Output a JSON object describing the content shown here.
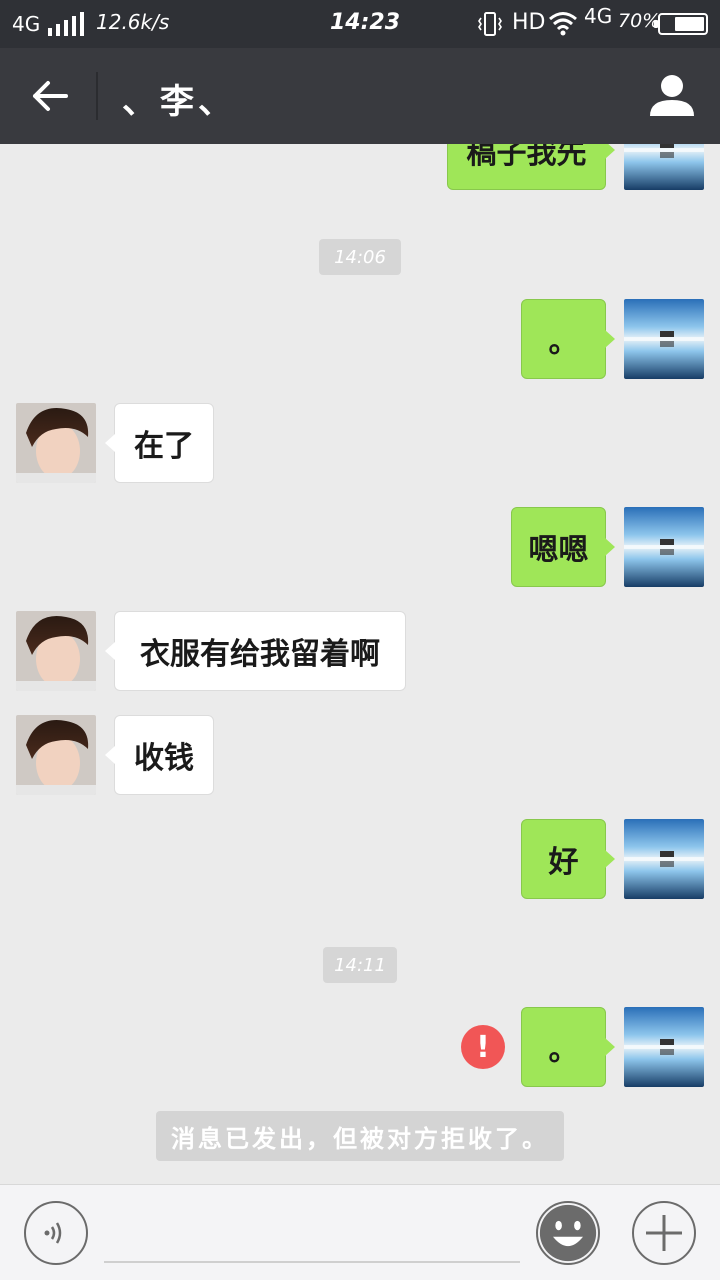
{
  "status_bar": {
    "network": "4G",
    "speed": "12.6k/s",
    "time": "14:23",
    "hd": "HD",
    "network2": "4G",
    "battery": "70%",
    "battery_level": 0.7
  },
  "header": {
    "title": "、李、"
  },
  "messages": [
    {
      "type": "sent",
      "text": "稿子我先"
    },
    {
      "type": "time",
      "text": "14:06"
    },
    {
      "type": "sent",
      "text": "。"
    },
    {
      "type": "recv",
      "text": "在了"
    },
    {
      "type": "sent",
      "text": "嗯嗯"
    },
    {
      "type": "recv",
      "text": "衣服有给我留着啊"
    },
    {
      "type": "recv",
      "text": "收钱"
    },
    {
      "type": "sent",
      "text": "好"
    },
    {
      "type": "time",
      "text": "14:11"
    },
    {
      "type": "sent",
      "text": "。",
      "error": "!"
    },
    {
      "type": "notice",
      "text": "消息已发出，但被对方拒收了。"
    }
  ],
  "input": {
    "value": ""
  },
  "colors": {
    "header_bg": "#393a3f",
    "sent_bubble": "#9fe658",
    "chat_bg": "#ebebeb",
    "error": "#f15656"
  }
}
